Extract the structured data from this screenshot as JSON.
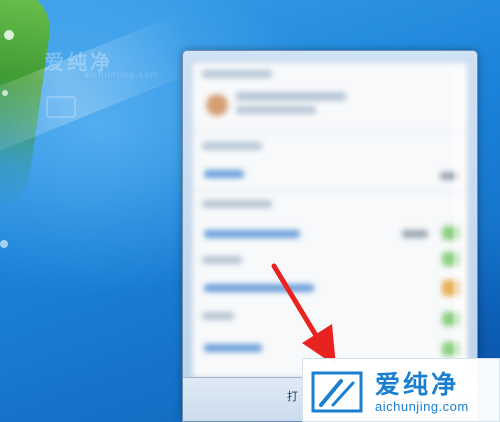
{
  "desktop": {
    "watermark_text": "爱纯净",
    "watermark_sub": "aichunjing.com"
  },
  "popup": {
    "footer_link": "打"
  },
  "brand": {
    "name": "爱纯净",
    "url": "aichunjing.com",
    "logo_icon": "aichunjing-logo-icon",
    "color": "#1a7fd1"
  },
  "annotation": {
    "arrow_icon": "red-arrow-icon",
    "color": "#e8231f"
  }
}
